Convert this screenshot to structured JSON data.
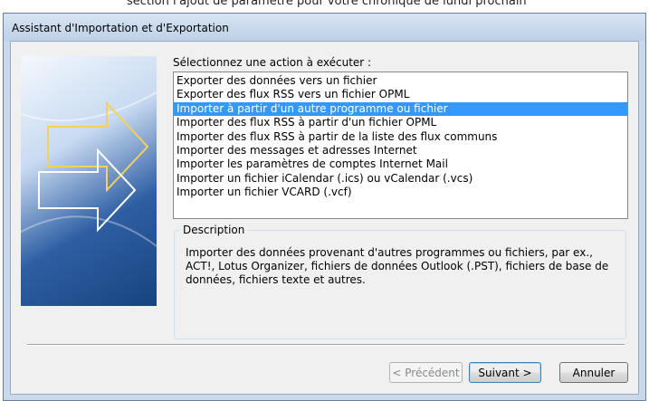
{
  "background": {
    "partial_text": "section l'ajout de paramètre pour votre chronique de lundi prochain"
  },
  "window": {
    "title": "Assistant d'Importation et d'Exportation"
  },
  "prompt": "Sélectionnez une action à exécuter :",
  "actions": [
    {
      "label": "Exporter des données vers un fichier",
      "selected": false
    },
    {
      "label": "Exporter des flux RSS vers un fichier OPML",
      "selected": false
    },
    {
      "label": "Importer à partir d'un autre programme ou fichier",
      "selected": true
    },
    {
      "label": "Importer des flux RSS à partir d'un fichier OPML",
      "selected": false
    },
    {
      "label": "Importer des flux RSS à partir de la liste des flux communs",
      "selected": false
    },
    {
      "label": "Importer des messages et adresses Internet",
      "selected": false
    },
    {
      "label": "Importer les paramètres de comptes Internet Mail",
      "selected": false
    },
    {
      "label": "Importer un fichier iCalendar (.ics) ou vCalendar (.vcs)",
      "selected": false
    },
    {
      "label": "Importer un fichier VCARD (.vcf)",
      "selected": false
    }
  ],
  "description": {
    "legend": "Description",
    "text": "Importer des données provenant d'autres programmes ou fichiers, par ex., ACT!, Lotus Organizer, fichiers de données Outlook (.PST), fichiers de base de données, fichiers texte et autres."
  },
  "buttons": {
    "previous": "< Précédent",
    "next": "Suivant >",
    "cancel": "Annuler"
  },
  "colors": {
    "selection": "#3399ff",
    "titlebar": "#c9d8ea",
    "art_dark": "#17437f"
  }
}
